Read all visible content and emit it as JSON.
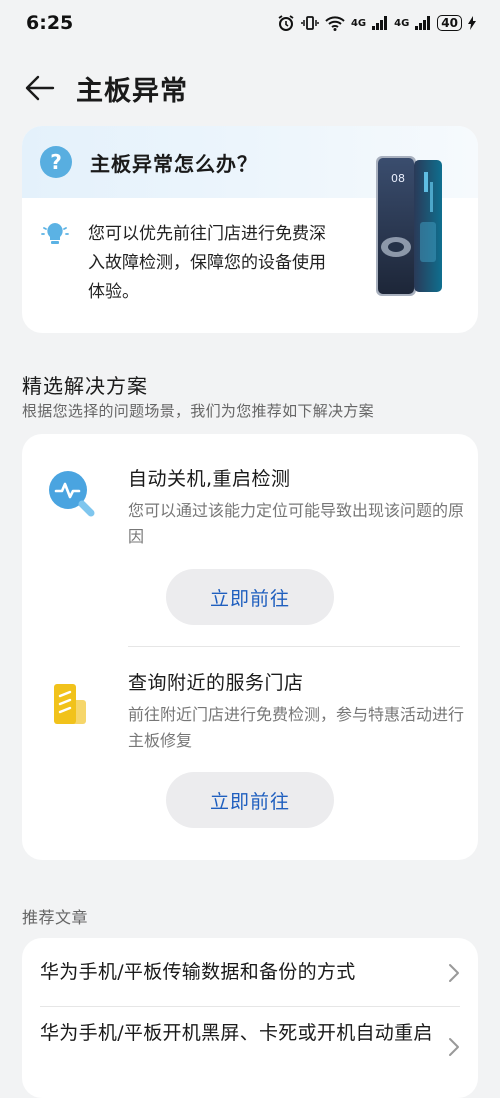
{
  "status": {
    "time": "6:25",
    "signal_1": "4G",
    "signal_2": "4G",
    "battery": "40"
  },
  "header": {
    "title": "主板异常"
  },
  "hero": {
    "question": "主板异常怎么办？",
    "answer": "您可以优先前往门店进行免费深入故障检测，保障您的设备使用体验。",
    "phone_screen_time": "08"
  },
  "solutions_section": {
    "title": "精选解决方案",
    "subtitle": "根据您选择的问题场景，我们为您推荐如下解决方案"
  },
  "solutions": [
    {
      "title": "自动关机,重启检测",
      "desc": "您可以通过该能力定位可能导致出现该问题的原因",
      "button": "立即前往",
      "icon": "diagnosis-search-icon"
    },
    {
      "title": "查询附近的服务门店",
      "desc": "前往附近门店进行免费检测，参与特惠活动进行主板修复",
      "button": "立即前往",
      "icon": "service-store-icon"
    }
  ],
  "articles_section": {
    "title": "推荐文章"
  },
  "articles": [
    {
      "title": "华为手机/平板传输数据和备份的方式"
    },
    {
      "title": "华为手机/平板开机黑屏、卡死或开机自动重启"
    }
  ],
  "colors": {
    "accent": "#1f5fbf",
    "background": "#f2f3f4",
    "hero_bg": "#e4f1fb"
  }
}
